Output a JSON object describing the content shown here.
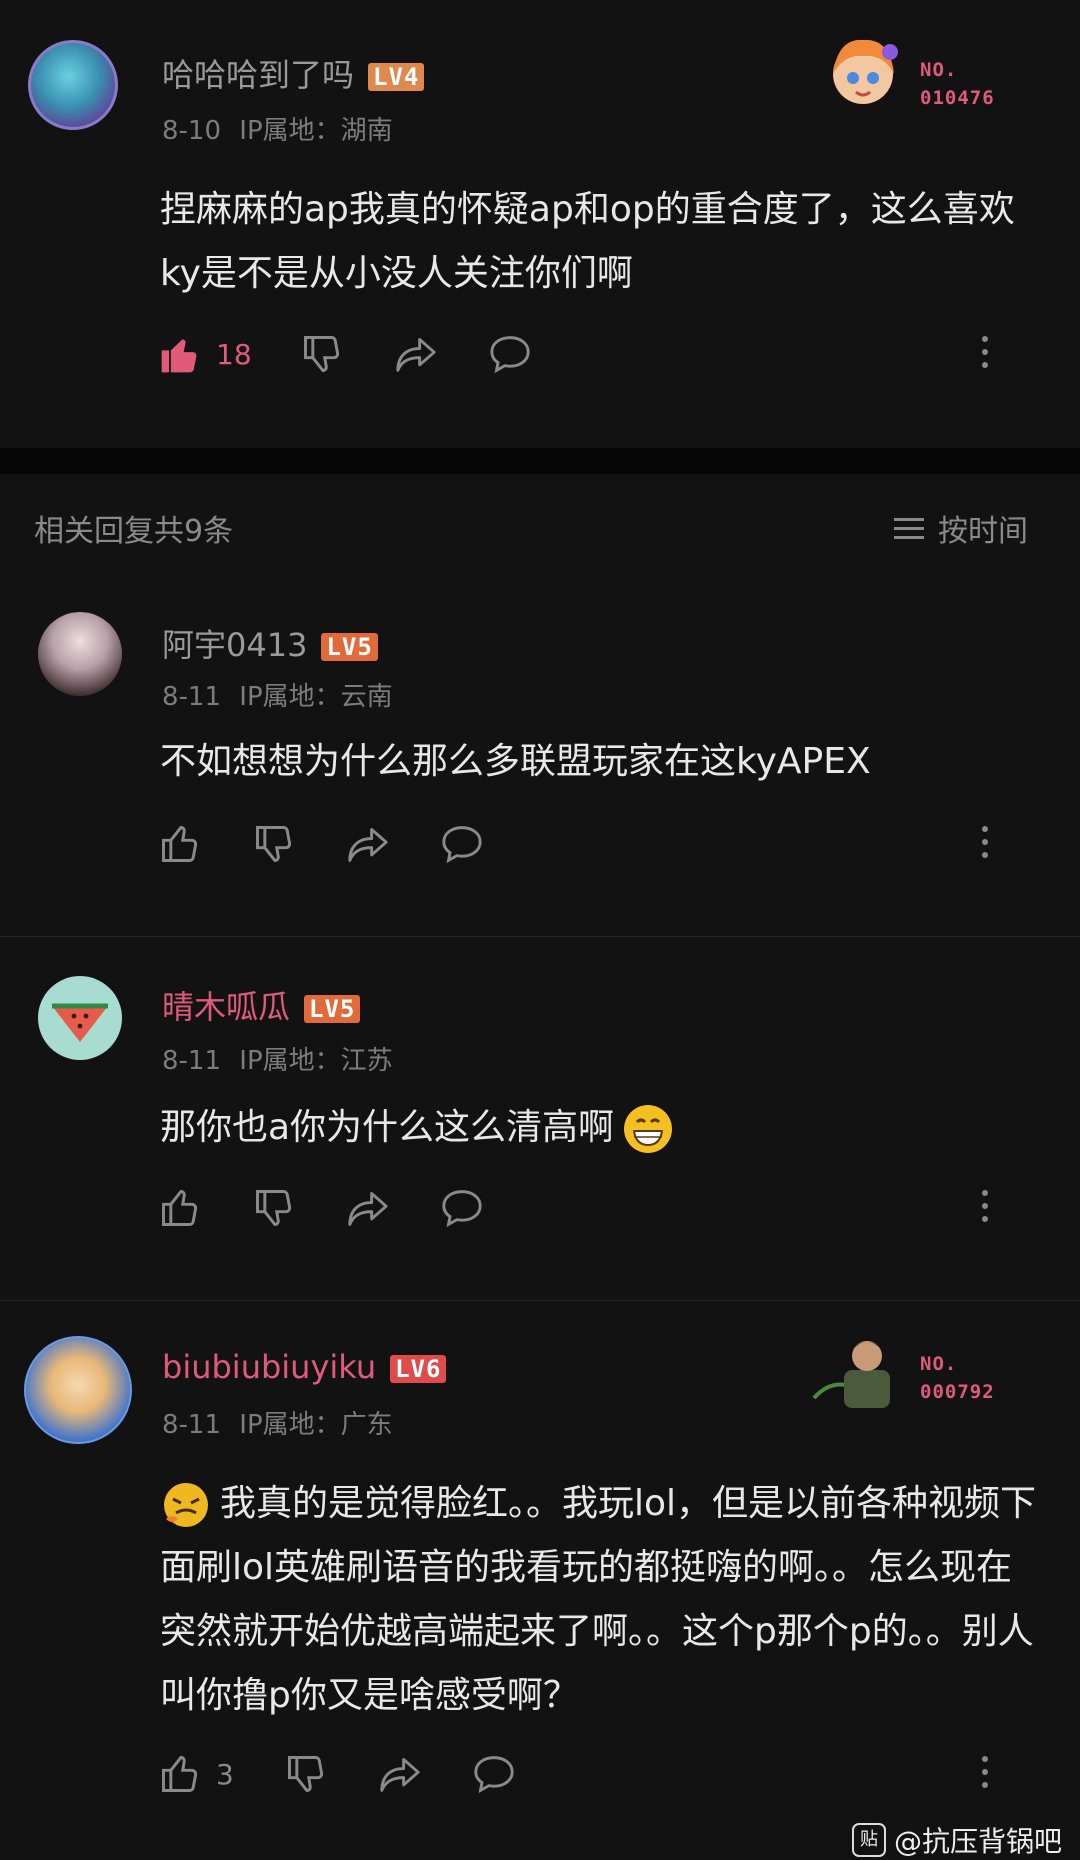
{
  "main_comment": {
    "username": "哈哈哈到了吗",
    "level": "LV4",
    "date": "8-10",
    "ip": "IP属地：湖南",
    "badge_no_label": "NO.",
    "badge_no_value": "010476",
    "content": "捏麻麻的ap我真的怀疑ap和op的重合度了，这么喜欢ky是不是从小没人关注你们啊",
    "like_count": "18",
    "liked": true
  },
  "replies_header": {
    "title": "相关回复共9条",
    "sort_label": "按时间"
  },
  "replies": [
    {
      "username": "阿宇0413",
      "level": "LV5",
      "date": "8-11",
      "ip": "IP属地：云南",
      "content": "不如想想为什么那么多联盟玩家在这kyAPEX"
    },
    {
      "username": "晴木呱瓜",
      "level": "LV5",
      "date": "8-11",
      "ip": "IP属地：江苏",
      "content": "那你也a你为什么这么清高啊"
    },
    {
      "username": "biubiubiuyiku",
      "level": "LV6",
      "date": "8-11",
      "ip": "IP属地：广东",
      "badge_no_label": "NO.",
      "badge_no_value": "000792",
      "content": "我真的是觉得脸红。。我玩lol，但是以前各种视频下面刷lol英雄刷语音的我看玩的都挺嗨的啊。。怎么现在突然就开始优越高端起来了啊。。这个p那个p的。。别人叫你撸p你又是啥感受啊？",
      "like_count": "3"
    }
  ],
  "watermark": {
    "text": "@抗压背锅吧",
    "logo_text": "贴"
  },
  "colors": {
    "background": "#121212",
    "accent_pink": "#e05a7a",
    "lv4": "#e0894e",
    "lv5": "#e06a3a",
    "lv6": "#e04b4b"
  }
}
